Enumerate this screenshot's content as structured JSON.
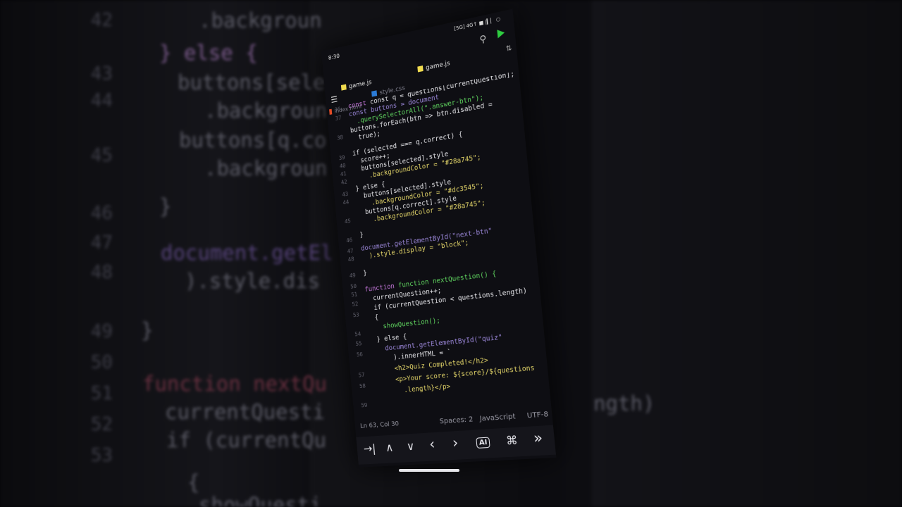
{
  "background_zoom": {
    "line_numbers": [
      "42",
      "43",
      "44",
      "45",
      "46",
      "47",
      "48",
      "49",
      "50",
      "51",
      "52",
      "53"
    ],
    "lines": [
      ".backgroun",
      "} else {",
      "buttons[sele",
      ".backgroun",
      "buttons[q.co",
      ".backgroun",
      "}",
      "document.getEl",
      ").style.dis",
      "}",
      "function nextQu",
      "currentQuesti",
      "if (currentQu",
      "{",
      "showQuesti"
    ],
    "right_fragment": "ngth)"
  },
  "status_bar": {
    "time": "8:30",
    "icons": "[5G] 4G↑ ■ |▎▏ ○"
  },
  "toolbar": {
    "search_icon": "search-icon",
    "run_icon": "play-icon"
  },
  "tabs": [
    {
      "label": "game.js",
      "icon_color": "#f0db4f",
      "active": true
    },
    {
      "label": "style.css",
      "icon_color": "#2b7bd6",
      "active": false
    },
    {
      "label": "game.js",
      "icon_color": "#f0db4f",
      "active": true
    },
    {
      "label": "index.html",
      "icon_color": "#e34c26",
      "active": false
    }
  ],
  "editor": {
    "line_numbers": [
      "36",
      "37",
      "38",
      "39",
      "40",
      "41",
      "42",
      "43",
      "44",
      "45",
      "46",
      "47",
      "48",
      "49",
      "50",
      "51",
      "52",
      "53",
      "54",
      "55",
      "56",
      "57",
      "58",
      "59"
    ],
    "lines": [
      "const q = questions[currentQuestion];",
      "const buttons = document",
      "  .querySelectorAll(\".answer-btn\");",
      "buttons.forEach(btn => btn.disabled =",
      "  true);",
      "",
      "if (selected === q.correct) {",
      "  score++;",
      "  buttons[selected].style",
      "    .backgroundColor = \"#28a745\";",
      "} else {",
      "  buttons[selected].style",
      "    .backgroundColor = \"#dc3545\";",
      "  buttons[q.correct].style",
      "    .backgroundColor = \"#28a745\";",
      "}",
      "",
      "document.getElementById(\"next-btn\"",
      "  ).style.display = \"block\";",
      "}",
      "",
      "function nextQuestion() {",
      "  currentQuestion++;",
      "  if (currentQuestion < questions.length)",
      "  {",
      "    showQuestion();",
      "  } else {",
      "    document.getElementById(\"quiz\"",
      "      ).innerHTML = `",
      "      <h2>Quiz Completed!</h2>",
      "      <p>Your score: ${score}/${questions",
      "        .length}</p>"
    ]
  },
  "footer": {
    "cursor": "Ln 63, Col 30",
    "spaces": "Spaces: 2",
    "language": "JavaScript",
    "encoding": "UTF-8"
  },
  "keybar": {
    "tab": "→|",
    "up": "∧",
    "down": "∨",
    "left": "‹",
    "right": "›",
    "ai": "AI",
    "cmd": "⌘",
    "more": "»"
  }
}
